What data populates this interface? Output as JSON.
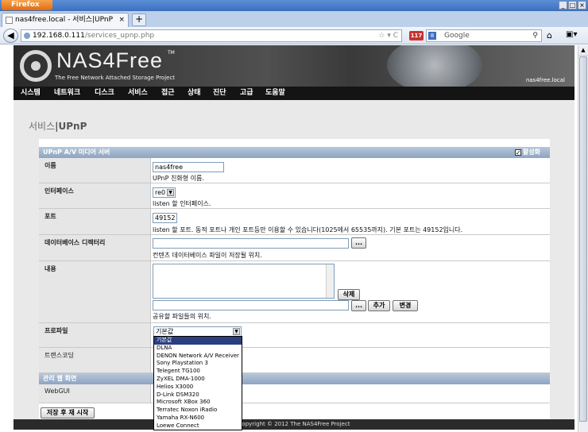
{
  "browser": {
    "app_label": "Firefox",
    "tab_title": "nas4free.local - 서비스|UPnP",
    "tab_close": "×",
    "new_tab": "+",
    "url_host": "192.168.0.111",
    "url_path": "/services_upnp.php",
    "url_controls": "☆ ▾ C",
    "badge": "117",
    "search_engine": "8",
    "search_placeholder": "Google",
    "window_buttons": [
      "_",
      "□",
      "×"
    ]
  },
  "header": {
    "logo": "NAS4Free",
    "tm": "TM",
    "tagline": "The Free Network Attached Storage Project",
    "hostname": "nas4free.local"
  },
  "menu": [
    "시스템",
    "네트워크",
    "디스크",
    "서비스",
    "접근",
    "상태",
    "진단",
    "고급",
    "도움말"
  ],
  "page": {
    "title_section": "서비스",
    "title_sep": "|",
    "title_page": "UPnP"
  },
  "section": {
    "title": "UPnP A/V 미디어 서버",
    "enable_label": "활성화",
    "enabled": true
  },
  "fields": {
    "name": {
      "label": "이름",
      "value": "nas4free",
      "hint": "UPnP 친화형 이름."
    },
    "interface": {
      "label": "인터페이스",
      "value": "re0",
      "hint": "listen 할 인터페이스."
    },
    "port": {
      "label": "포트",
      "value": "49152",
      "hint": "listen 할 포트. 동적 포트나 개인 포트등만 이용할 수 있습니다(1025에서 65535까지). 기본 포트는 49152입니다."
    },
    "dbdir": {
      "label": "데이터베이스 디렉터리",
      "value": "",
      "browse": "...",
      "hint": "컨텐츠 데이터베이스 파일이 저장될 위치."
    },
    "content": {
      "label": "내용",
      "delete_btn": "삭제",
      "browse": "...",
      "add_btn": "추가",
      "change_btn": "변경",
      "hint": "공유할 파일들의 위치."
    },
    "profile": {
      "label": "프로파일",
      "value": "기본값"
    },
    "transcoding": {
      "label": "트랜스코딩"
    }
  },
  "profile_options": [
    "기본값",
    "DLNA",
    "DENON Network A/V Receiver",
    "Sony Playstation 3",
    "Telegent TG100",
    "ZyXEL DMA-1000",
    "Helios X3000",
    "D-Link DSM320",
    "Microsoft XBox 360",
    "Terratec Noxon iRadio",
    "Yamaha RX-N600",
    "Loewe Connect"
  ],
  "admin": {
    "title": "관리 웹 화면",
    "webgui_label": "WebGUI",
    "save_btn": "저장 후 재 시작"
  },
  "footer": "Copyright © 2012 The NAS4Free Project"
}
